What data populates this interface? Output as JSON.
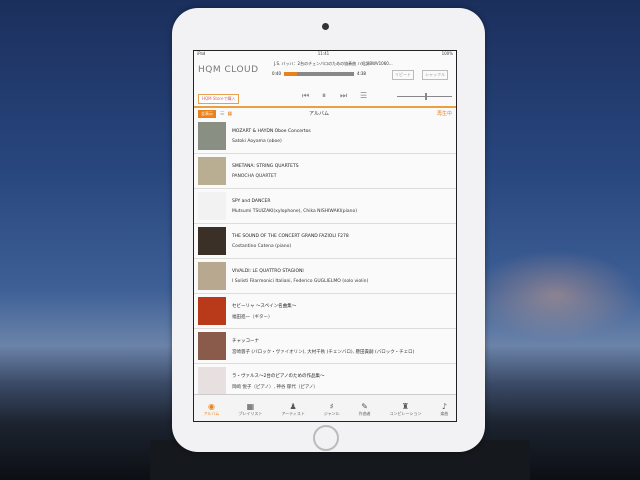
{
  "status": {
    "device": "iPad",
    "time": "11:41",
    "battery": "100%"
  },
  "app": {
    "logo": "HQM CLOUD",
    "store_button": "HQM Storeで購入"
  },
  "now_playing": {
    "title": "J.S. バッハ：2台のチェンバロのための協奏曲 ハ短調BWV1060...",
    "elapsed": "0:40",
    "remaining": "4:38",
    "progress": 0.18,
    "volume": 0.5
  },
  "header_buttons": {
    "repeat": "リピート",
    "shuffle": "シャッフル"
  },
  "subbar": {
    "all": "全表示",
    "title": "アルバム",
    "playing": "再生中"
  },
  "albums": [
    {
      "title": "MOZART & HAYDN Oboe Concertos",
      "artist": "Satoki Aoyama (oboe)",
      "color": "#8a8f84"
    },
    {
      "title": "SMETANA: STRING QUARTETS",
      "artist": "PANOCHA QUARTET",
      "color": "#b9ae92"
    },
    {
      "title": "SPY and DANCER",
      "artist": "Mutsumi TSUIZAKI(xylophone), Chika NISHIWAKI(piano)",
      "color": "#f2f2f2"
    },
    {
      "title": "THE SOUND OF THE CONCERT GRAND FAZIOLI F278",
      "artist": "Costantino Catena (piano)",
      "color": "#3a3028"
    },
    {
      "title": "VIVALDI: LE QUATTRO STAGIONI",
      "artist": "I Solisti Filarmonici Italiani, Federico GUGLIELMO (solo violin)",
      "color": "#b8a890"
    },
    {
      "title": "セビーリャ 〜スペイン名曲集〜",
      "artist": "福田進一（ギター）",
      "color": "#b83a1a"
    },
    {
      "title": "チャッコーナ",
      "artist": "宮崎蓉子 (バロック・ヴァイオリン), 大村千秋 (チェンバロ), 懸田貴嗣 (バロック・チェロ)",
      "color": "#8a5a4a"
    },
    {
      "title": "ラ・ヴァルス〜2台のピアノのための作品集〜",
      "artist": "岡﨑 悦子（ピアノ）, 神谷 郁代（ピアノ）",
      "color": "#e8e0e0"
    }
  ],
  "tabs": [
    {
      "label": "アルバム",
      "icon": "◉"
    },
    {
      "label": "プレイリスト",
      "icon": "▦"
    },
    {
      "label": "アーティスト",
      "icon": "♟"
    },
    {
      "label": "ジャンル",
      "icon": "♯"
    },
    {
      "label": "作曲者",
      "icon": "✎"
    },
    {
      "label": "コンピレーション",
      "icon": "♜"
    },
    {
      "label": "楽曲",
      "icon": "♪"
    }
  ]
}
